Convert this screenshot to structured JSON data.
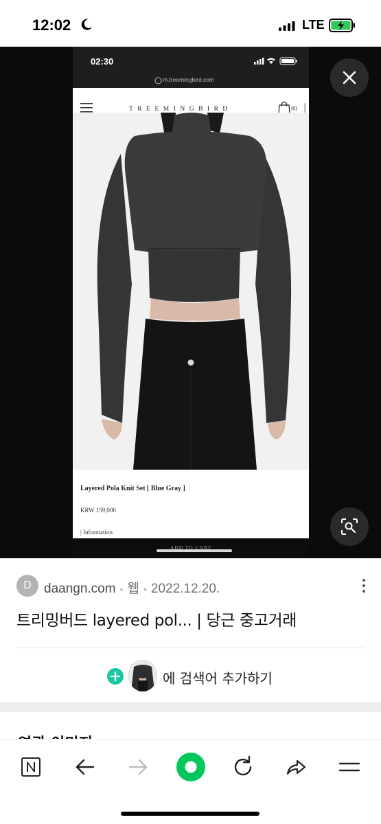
{
  "status_bar": {
    "time": "12:02",
    "network": "LTE"
  },
  "viewer": {
    "close_icon": "close-icon",
    "lens_icon": "lens-search-icon",
    "screenshot": {
      "time": "02:30",
      "url": "m.treemingbird.com",
      "brand": "TREEMINGBIRD",
      "bag_count": "(0)",
      "product_name": "Layered Pola Knit Set [ Blue Gray ]",
      "price": "KRW 159,000",
      "info": "| Information",
      "cart": "ADD TO CART"
    }
  },
  "result": {
    "favicon_letter": "D",
    "source": "daangn.com",
    "type": "웹",
    "date": "2022.12.20.",
    "title": "트리밍버드 layered pol... | 당근 중고거래",
    "add_search_text": "에 검색어 추가하기"
  },
  "related": {
    "title": "연관 이미지"
  },
  "toolbar": {
    "items": [
      "naver-icon",
      "back-arrow-icon",
      "forward-arrow-icon",
      "home-green-icon",
      "refresh-icon",
      "share-icon",
      "menu-icon"
    ]
  },
  "colors": {
    "accent_green": "#03c75a",
    "add_plus": "#18c7a0",
    "viewer_bg": "#0b0b0b"
  }
}
